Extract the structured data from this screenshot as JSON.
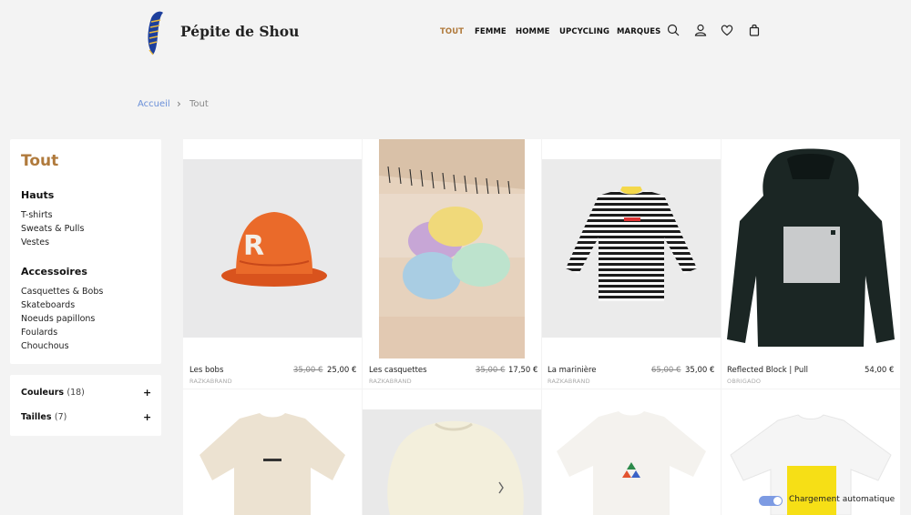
{
  "header": {
    "brand": "Pépite de Shou",
    "nav": [
      "TOUT",
      "FEMME",
      "HOMME",
      "UPCYCLING",
      "MARQUES"
    ],
    "icons": [
      "search-icon",
      "account-icon",
      "heart-icon",
      "bag-icon"
    ],
    "accent": "#b07a3c"
  },
  "breadcrumb": {
    "home": "Accueil",
    "separator": "›",
    "current": "Tout"
  },
  "sidebar": {
    "title": "Tout",
    "groups": [
      {
        "heading": "Hauts",
        "links": [
          "T-shirts",
          "Sweats & Pulls",
          "Vestes"
        ]
      },
      {
        "heading": "Accessoires",
        "links": [
          "Casquettes & Bobs",
          "Skateboards",
          "Noeuds papillons",
          "Foulards",
          "Chouchous"
        ]
      }
    ],
    "filters": [
      {
        "label": "Couleurs",
        "count": "(18)"
      },
      {
        "label": "Tailles",
        "count": "(7)"
      }
    ]
  },
  "products": [
    {
      "name": "Les bobs",
      "brand": "RAZKABRAND",
      "old_price": "35,00 €",
      "price": "25,00 €"
    },
    {
      "name": "Les casquettes",
      "brand": "RAZKABRAND",
      "old_price": "35,00 €",
      "price": "17,50 €"
    },
    {
      "name": "La marinière",
      "brand": "RAZKABRAND",
      "old_price": "65,00 €",
      "price": "35,00 €"
    },
    {
      "name": "Reflected Block | Pull",
      "brand": "OBRIGADO",
      "old_price": "",
      "price": "54,00 €"
    }
  ],
  "autoload": {
    "label": "Chargement automatique",
    "enabled": true
  }
}
